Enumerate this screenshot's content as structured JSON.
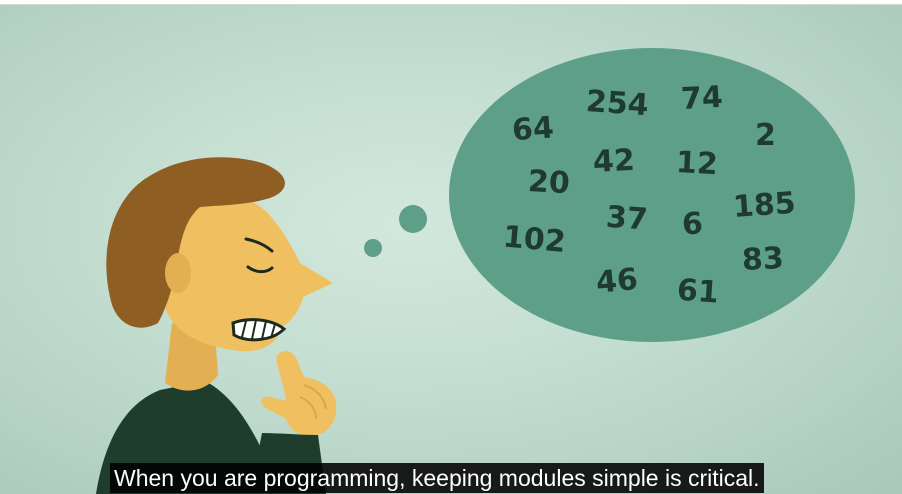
{
  "bubble_numbers": [
    "254",
    "74",
    "64",
    "2",
    "42",
    "12",
    "20",
    "185",
    "37",
    "6",
    "102",
    "83",
    "46",
    "61"
  ],
  "subtitle": "When you are programming, keeping modules simple is critical.",
  "colors": {
    "background": "#c7e0d3",
    "bubble": "#5e9f8a",
    "bubble_text": "#1f3a2f",
    "skin": "#f0c060",
    "hair": "#8e5e22",
    "shirt": "#1e3d2c",
    "subtitle_bg": "#000000",
    "subtitle_text": "#ffffff"
  }
}
